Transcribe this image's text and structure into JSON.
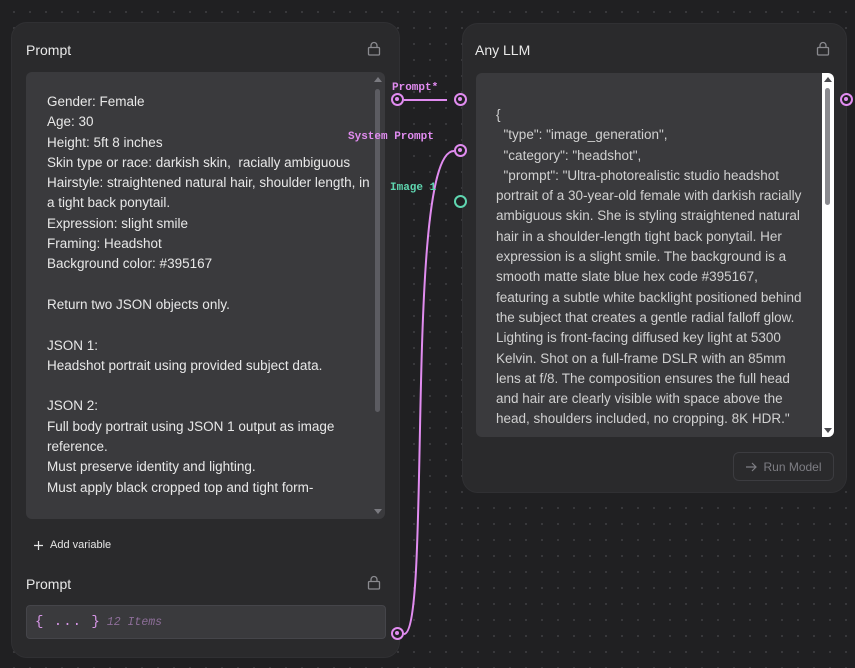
{
  "prompt_node": {
    "title": "Prompt",
    "text": "Gender: Female\nAge: 30\nHeight: 5ft 8 inches\nSkin type or race: darkish skin,  racially ambiguous\nHairstyle: straightened natural hair, shoulder length, in a tight back ponytail.\nExpression: slight smile\nFraming: Headshot\nBackground color: #395167\n\nReturn two JSON objects only.\n\nJSON 1:\nHeadshot portrait using provided subject data.\n\nJSON 2:\nFull body portrait using JSON 1 output as image reference.\nMust preserve identity and lighting.\nMust apply black cropped top and tight form-",
    "add_variable_label": "Add variable"
  },
  "second_prompt_node": {
    "title": "Prompt",
    "value_braces": "{ ... }",
    "value_count": "12 Items"
  },
  "llm_node": {
    "title": "Any LLM",
    "output_text": "{\n  \"type\": \"image_generation\",\n  \"category\": \"headshot\",\n  \"prompt\": \"Ultra-photorealistic studio headshot portrait of a 30-year-old female with darkish racially ambiguous skin. She is styling straightened natural hair in a shoulder-length tight back ponytail. Her expression is a slight smile. The background is a smooth matte slate blue hex code #395167, featuring a subtle white backlight positioned behind the subject that creates a gentle radial falloff glow. Lighting is front-facing diffused key light at 5300 Kelvin. Shot on a full-frame DSLR with an 85mm lens at f/8. The composition ensures the full head and hair are clearly visible with space above the head, shoulders included, no cropping. 8K HDR.\"",
    "run_button_label": "Run Model",
    "run_button_icon": "arrow-right-icon"
  },
  "handles": {
    "prompt_label": "Prompt*",
    "system_prompt_label": "System Prompt",
    "image_label": "Image 1"
  },
  "colors": {
    "canvas": "#202022",
    "node": "#2a2a2c",
    "field": "#3a3a3d",
    "text_handle": "#e18cf0",
    "image_handle": "#5fd6b0"
  }
}
